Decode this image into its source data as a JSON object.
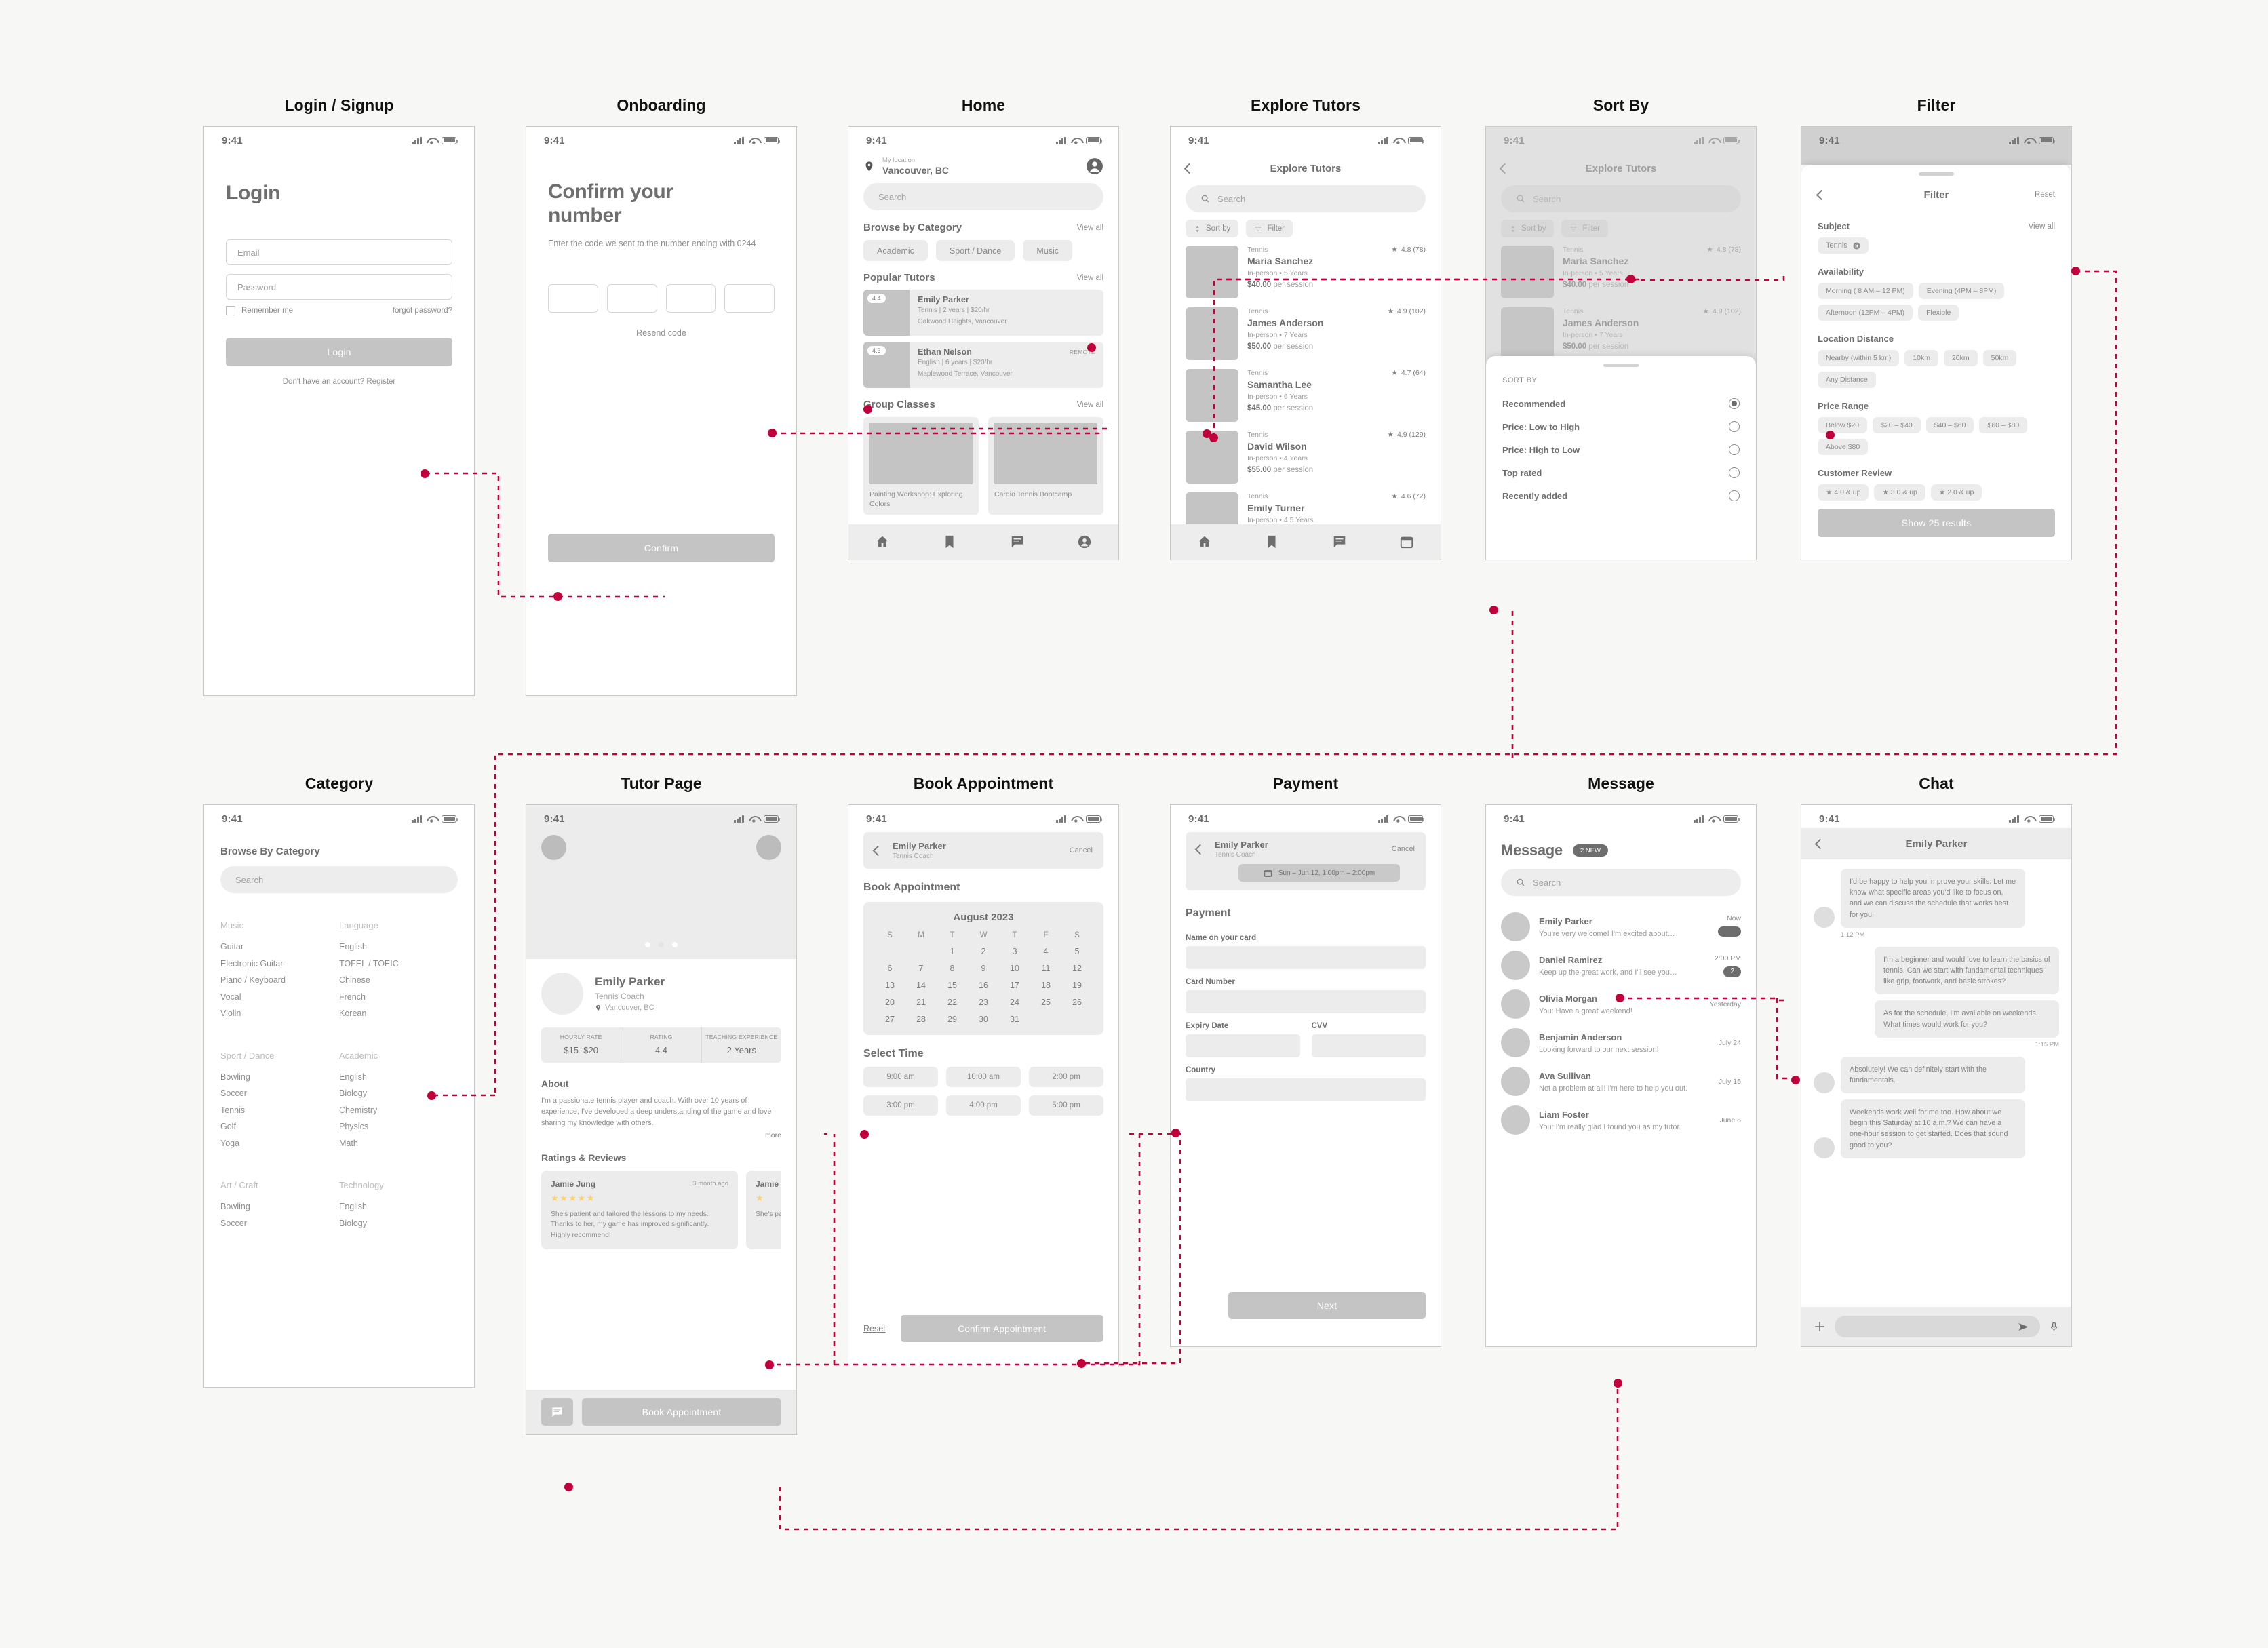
{
  "status_bar": {
    "time": "9:41"
  },
  "screens": {
    "login": {
      "title": "Login / Signup",
      "heading": "Login",
      "email_placeholder": "Email",
      "password_placeholder": "Password",
      "remember_label": "Remember me",
      "forgot_label": "forgot password?",
      "login_button": "Login",
      "register_text": "Don't have an account? Register"
    },
    "onboarding": {
      "title": "Onboarding",
      "heading": "Confirm your number",
      "subtext": "Enter the code we sent to the number ending with 0244",
      "resend_label": "Resend code",
      "confirm_button": "Confirm"
    },
    "home": {
      "title": "Home",
      "location_label": "My location",
      "location_value": "Vancouver, BC",
      "search_placeholder": "Search",
      "category_section": "Browse by Category",
      "view_all": "View all",
      "categories": [
        "Academic",
        "Sport / Dance",
        "Music"
      ],
      "popular_section": "Popular Tutors",
      "popular_tutors": [
        {
          "rating": "4.4",
          "name": "Emily Parker",
          "meta": "Tennis  |  2 years  |  $20/hr",
          "location": "Oakwood Heights, Vancouver",
          "badge": ""
        },
        {
          "rating": "4.3",
          "name": "Ethan Nelson",
          "meta": "English  |  6 years  |  $20/hr",
          "location": "Maplewood Terrace, Vancouver",
          "badge": "REMOTE"
        }
      ],
      "group_section": "Group Classes",
      "group_classes": [
        "Painting Workshop: Exploring Colors",
        "Cardio Tennis Bootcamp"
      ]
    },
    "explore": {
      "title": "Explore Tutors",
      "header": "Explore Tutors",
      "search_placeholder": "Search",
      "sort_label": "Sort by",
      "filter_label": "Filter",
      "tutors": [
        {
          "subject": "Tennis",
          "name": "Maria Sanchez",
          "mode": "In-person  •  5 Years",
          "price": "$40.00",
          "price_unit": "per session",
          "rating": "4.8 (78)"
        },
        {
          "subject": "Tennis",
          "name": "James Anderson",
          "mode": "In-person  •  7 Years",
          "price": "$50.00",
          "price_unit": "per session",
          "rating": "4.9 (102)"
        },
        {
          "subject": "Tennis",
          "name": "Samantha Lee",
          "mode": "In-person  •  6 Years",
          "price": "$45.00",
          "price_unit": "per session",
          "rating": "4.7 (64)"
        },
        {
          "subject": "Tennis",
          "name": "David Wilson",
          "mode": "In-person  •  4 Years",
          "price": "$55.00",
          "price_unit": "per session",
          "rating": "4.9 (129)"
        },
        {
          "subject": "Tennis",
          "name": "Emily Turner",
          "mode": "In-person  •  4.5 Years",
          "price": "",
          "price_unit": "",
          "rating": "4.6 (72)"
        }
      ]
    },
    "sort": {
      "title": "Sort By",
      "sheet_label": "SORT BY",
      "options": [
        "Recommended",
        "Price: Low to High",
        "Price: High to Low",
        "Top rated",
        "Recently added"
      ],
      "selected_index": 0
    },
    "filter": {
      "title": "Filter",
      "header": "Filter",
      "reset_label": "Reset",
      "subject_label": "Subject",
      "view_all": "View all",
      "subject_chip": "Tennis",
      "availability_label": "Availability",
      "availability": [
        "Morning ( 8 AM – 12 PM)",
        "Evening (4PM – 8PM)",
        "Afternoon (12PM – 4PM)",
        "Flexible"
      ],
      "distance_label": "Location Distance",
      "distances": [
        "Nearby (within 5 km)",
        "10km",
        "20km",
        "50km",
        "Any Distance"
      ],
      "price_label": "Price Range",
      "prices": [
        "Below $20",
        "$20 – $40",
        "$40 – $60",
        "$60 – $80",
        "Above $80"
      ],
      "review_label": "Customer Review",
      "reviews": [
        "★ 4.0 & up",
        "★ 3.0 & up",
        "★ 2.0 & up"
      ],
      "show_button": "Show 25 results"
    },
    "category": {
      "title": "Category",
      "heading": "Browse By Category",
      "search_placeholder": "Search",
      "groups": [
        {
          "name": "Music",
          "items": [
            "Guitar",
            "Electronic Guitar",
            "Piano / Keyboard",
            "Vocal",
            "Violin"
          ]
        },
        {
          "name": "Language",
          "items": [
            "English",
            "TOFEL / TOEIC",
            "Chinese",
            "French",
            "Korean"
          ]
        },
        {
          "name": "Sport / Dance",
          "items": [
            "Bowling",
            "Soccer",
            "Tennis",
            "Golf",
            "Yoga"
          ]
        },
        {
          "name": "Academic",
          "items": [
            "English",
            "Biology",
            "Chemistry",
            "Physics",
            "Math"
          ]
        },
        {
          "name": "Art / Craft",
          "items": [
            "Bowling",
            "Soccer"
          ]
        },
        {
          "name": "Technology",
          "items": [
            "English",
            "Biology"
          ]
        }
      ]
    },
    "tutor": {
      "title": "Tutor Page",
      "name": "Emily Parker",
      "role": "Tennis Coach",
      "location": "Vancouver, BC",
      "stats": [
        {
          "label": "HOURLY RATE",
          "value": "$15–$20"
        },
        {
          "label": "RATING",
          "value": "4.4"
        },
        {
          "label": "TEACHING EXPERIENCE",
          "value": "2 Years"
        }
      ],
      "about_label": "About",
      "about_text": "I'm a passionate tennis player and coach. With over 10 years of experience, I've developed a deep understanding of the game and love sharing my knowledge with others.",
      "more_label": "more",
      "reviews_label": "Ratings & Reviews",
      "reviews": [
        {
          "author": "Jamie Jung",
          "when": "3 month ago",
          "stars": "★★★★★",
          "text": "She's patient and tailored the lessons to my needs. Thanks to her, my game has improved significantly. Highly recommend!"
        },
        {
          "author": "Jamie Jung",
          "when": "",
          "stars": "★",
          "text": "She's patient and tailored the lessons to my needs."
        }
      ],
      "book_button": "Book Appointment"
    },
    "book": {
      "title": "Book Appointment",
      "tutor_name": "Emily Parker",
      "tutor_role": "Tennis Coach",
      "cancel_label": "Cancel",
      "heading": "Book Appointment",
      "month": "August 2023",
      "weekdays": [
        "S",
        "M",
        "T",
        "W",
        "T",
        "F",
        "S"
      ],
      "lead_blanks": 2,
      "days": [
        1,
        2,
        3,
        4,
        5,
        6,
        7,
        8,
        9,
        10,
        11,
        12,
        13,
        14,
        15,
        16,
        17,
        18,
        19,
        20,
        21,
        22,
        23,
        24,
        25,
        26,
        27,
        28,
        29,
        30,
        31
      ],
      "time_label": "Select Time",
      "times": [
        "9:00 am",
        "10:00 am",
        "2:00 pm",
        "3:00 pm",
        "4:00 pm",
        "5:00 pm"
      ],
      "reset_label": "Reset",
      "confirm_button": "Confirm Appointment"
    },
    "payment": {
      "title": "Payment",
      "tutor_name": "Emily Parker",
      "tutor_role": "Tennis Coach",
      "cancel_label": "Cancel",
      "slot_label": "Sun – Jun 12, 1:00pm – 2:00pm",
      "heading": "Payment",
      "fields": [
        "Name on your card",
        "Card Number",
        "Expiry Date",
        "CVV",
        "Country"
      ],
      "next_button": "Next"
    },
    "message": {
      "title": "Message",
      "heading": "Message",
      "badge": "2 NEW",
      "search_placeholder": "Search",
      "threads": [
        {
          "name": "Emily Parker",
          "preview": "You're very welcome! I'm excited about…",
          "time": "Now",
          "badge": ""
        },
        {
          "name": "Daniel Ramirez",
          "preview": "Keep up the great work, and I'll see you…",
          "time": "2:00 PM",
          "badge": "2"
        },
        {
          "name": "Olivia Morgan",
          "preview": "You: Have a great weekend!",
          "time": "Yesterday",
          "badge": ""
        },
        {
          "name": "Benjamin Anderson",
          "preview": "Looking forward to our next session!",
          "time": "July 24",
          "badge": ""
        },
        {
          "name": "Ava Sullivan",
          "preview": "Not a problem at all! I'm here to help you out.",
          "time": "July 15",
          "badge": ""
        },
        {
          "name": "Liam Foster",
          "preview": "You: I'm really glad I found you as my tutor.",
          "time": "June 6",
          "badge": ""
        }
      ]
    },
    "chat": {
      "title": "Chat",
      "header": "Emily Parker",
      "messages": [
        {
          "side": "in",
          "text": "I'd be happy to help you improve your skills. Let me know what specific areas you'd like to focus on, and we can discuss the schedule that works best for you.",
          "time": "1:12 PM"
        },
        {
          "side": "out",
          "text": "I'm a beginner and would love to learn the basics of tennis. Can we start with fundamental techniques like grip, footwork, and basic strokes?",
          "time": ""
        },
        {
          "side": "out",
          "text": "As for the schedule, I'm available on weekends. What times would work for you?",
          "time": "1:15 PM"
        },
        {
          "side": "in",
          "text": "Absolutely! We can definitely start with the fundamentals.",
          "time": ""
        },
        {
          "side": "in",
          "text": "Weekends work well for me too. How about we begin this Saturday at 10 a.m.? We can have a one-hour session to get started. Does that sound good to you?",
          "time": ""
        }
      ]
    }
  },
  "colors": {
    "accent": "#c2003c",
    "grey_button": "#c4c4c4",
    "panel": "#ececec"
  }
}
